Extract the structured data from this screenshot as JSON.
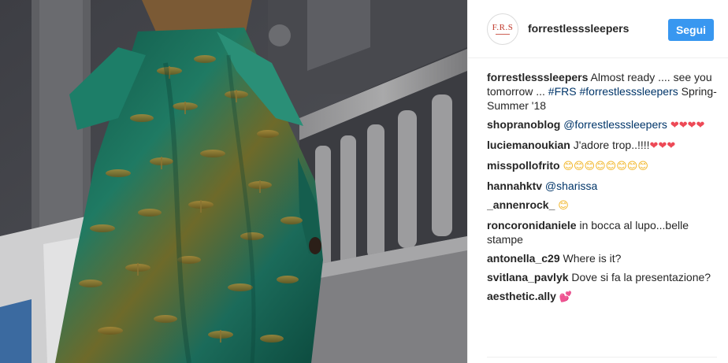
{
  "post": {
    "username": "forrestlesssleepers",
    "follow_label": "Segui",
    "avatar_text": "F.R.S"
  },
  "caption": {
    "username": "forrestlesssleepers",
    "text_before": "Almost ready .... see you tomorrow ... ",
    "hashtag1": "#FRS",
    "hashtag2": "#forrestlesssleepers",
    "text_after": "Spring-Summer '18"
  },
  "comments": [
    {
      "username": "shopranoblog",
      "mention": "@forrestlesssleepers",
      "emoji": "❤❤❤❤"
    },
    {
      "username": "luciemanoukian",
      "text": "J'adore trop..!!!!",
      "emoji": "❤❤❤"
    },
    {
      "username": "misspollofrito",
      "emoji": "😊😊😊😊😊😊😊😊"
    },
    {
      "username": "hannahktv",
      "mention": "@sharissa"
    },
    {
      "username": "_annenrock_",
      "emoji": "😊"
    },
    {
      "username": "roncoronidaniele",
      "text": "in bocca al lupo...belle stampe"
    },
    {
      "username": "antonella_c29",
      "text": "Where is it?"
    },
    {
      "username": "svitlana_pavlyk",
      "text": "Dove si fa la presentazione?"
    },
    {
      "username": "aesthetic.ally",
      "emoji": "💕"
    }
  ],
  "colors": {
    "follow_button": "#3897f0",
    "link": "#003569",
    "heart": "#ed4956",
    "garment": "#1b6b5a"
  },
  "photo": {
    "description_icon": "photo-image"
  }
}
